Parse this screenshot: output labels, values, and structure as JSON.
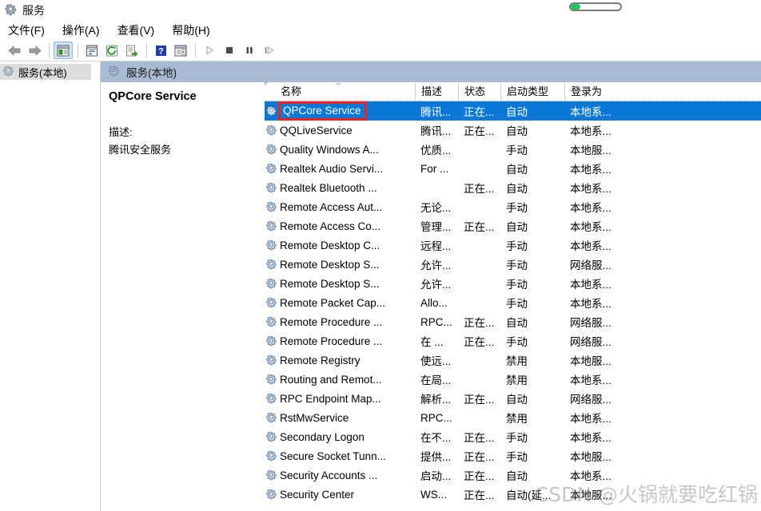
{
  "window": {
    "title": "服务",
    "icon": "services-gear-icon"
  },
  "progress": {
    "percent": 20,
    "fill_color": "#1fc45e"
  },
  "menu": {
    "items": [
      {
        "label": "文件(F)",
        "name": "menu-file"
      },
      {
        "label": "操作(A)",
        "name": "menu-action"
      },
      {
        "label": "查看(V)",
        "name": "menu-view"
      },
      {
        "label": "帮助(H)",
        "name": "menu-help"
      }
    ]
  },
  "toolbar": {
    "buttons": [
      {
        "name": "back-arrow-icon",
        "glyph": "←"
      },
      {
        "name": "forward-arrow-icon",
        "glyph": "→"
      },
      {
        "name": "show-hide-tree-icon",
        "glyph": "▤"
      },
      {
        "name": "properties-icon",
        "glyph": "▤"
      },
      {
        "name": "refresh-icon",
        "glyph": "↻"
      },
      {
        "name": "export-list-icon",
        "glyph": "☰"
      },
      {
        "name": "help-icon",
        "glyph": "?"
      },
      {
        "name": "show-action-pane-icon",
        "glyph": "▤"
      },
      {
        "name": "start-service-icon",
        "glyph": "▶"
      },
      {
        "name": "stop-service-icon",
        "glyph": "■"
      },
      {
        "name": "pause-service-icon",
        "glyph": "❙❙"
      },
      {
        "name": "restart-service-icon",
        "glyph": "❚▶"
      }
    ]
  },
  "tree": {
    "items": [
      {
        "label": "服务(本地)",
        "name": "tree-item-services-local",
        "selected": true
      }
    ]
  },
  "pane": {
    "header_label": "服务(本地)"
  },
  "detail": {
    "service_name": "QPCore Service",
    "description_label": "描述:",
    "description_text": "腾讯安全服务"
  },
  "list": {
    "columns": [
      {
        "key": "name",
        "label": "名称",
        "sorted": "asc"
      },
      {
        "key": "desc",
        "label": "描述"
      },
      {
        "key": "state",
        "label": "状态"
      },
      {
        "key": "start",
        "label": "启动类型"
      },
      {
        "key": "logon",
        "label": "登录为"
      }
    ],
    "rows": [
      {
        "name": "QPCore Service",
        "desc": "腾讯...",
        "state": "正在...",
        "start": "自动",
        "logon": "本地系...",
        "selected": true,
        "annotated": true
      },
      {
        "name": "QQLiveService",
        "desc": "腾讯...",
        "state": "正在...",
        "start": "自动",
        "logon": "本地系..."
      },
      {
        "name": "Quality Windows A...",
        "desc": "优质...",
        "state": "",
        "start": "手动",
        "logon": "本地服..."
      },
      {
        "name": "Realtek Audio Servi...",
        "desc": "For ...",
        "state": "",
        "start": "自动",
        "logon": "本地系..."
      },
      {
        "name": "Realtek Bluetooth ...",
        "desc": "",
        "state": "正在...",
        "start": "自动",
        "logon": "本地系..."
      },
      {
        "name": "Remote Access Aut...",
        "desc": "无论...",
        "state": "",
        "start": "手动",
        "logon": "本地系..."
      },
      {
        "name": "Remote Access Co...",
        "desc": "管理...",
        "state": "正在...",
        "start": "自动",
        "logon": "本地系..."
      },
      {
        "name": "Remote Desktop C...",
        "desc": "远程...",
        "state": "",
        "start": "手动",
        "logon": "本地系..."
      },
      {
        "name": "Remote Desktop S...",
        "desc": "允许...",
        "state": "",
        "start": "手动",
        "logon": "网络服..."
      },
      {
        "name": "Remote Desktop S...",
        "desc": "允许...",
        "state": "",
        "start": "手动",
        "logon": "本地系..."
      },
      {
        "name": "Remote Packet Cap...",
        "desc": "Allo...",
        "state": "",
        "start": "手动",
        "logon": "本地系..."
      },
      {
        "name": "Remote Procedure ...",
        "desc": "RPC...",
        "state": "正在...",
        "start": "自动",
        "logon": "网络服..."
      },
      {
        "name": "Remote Procedure ...",
        "desc": "在 ...",
        "state": "正在...",
        "start": "手动",
        "logon": "网络服..."
      },
      {
        "name": "Remote Registry",
        "desc": "使远...",
        "state": "",
        "start": "禁用",
        "logon": "本地服..."
      },
      {
        "name": "Routing and Remot...",
        "desc": "在局...",
        "state": "",
        "start": "禁用",
        "logon": "本地系..."
      },
      {
        "name": "RPC Endpoint Map...",
        "desc": "解析...",
        "state": "正在...",
        "start": "自动",
        "logon": "网络服..."
      },
      {
        "name": "RstMwService",
        "desc": "RPC...",
        "state": "",
        "start": "禁用",
        "logon": "本地系..."
      },
      {
        "name": "Secondary Logon",
        "desc": "在不...",
        "state": "正在...",
        "start": "手动",
        "logon": "本地系..."
      },
      {
        "name": "Secure Socket Tunn...",
        "desc": "提供...",
        "state": "正在...",
        "start": "手动",
        "logon": "本地服..."
      },
      {
        "name": "Security Accounts ...",
        "desc": "启动...",
        "state": "正在...",
        "start": "自动",
        "logon": "本地系..."
      },
      {
        "name": "Security Center",
        "desc": "WS...",
        "state": "正在...",
        "start": "自动(延...",
        "logon": "本地服..."
      }
    ]
  },
  "watermark": {
    "text": "CSDN @火锅就要吃红锅"
  },
  "colors": {
    "selection": "#0a78d4",
    "annotation": "#ee2222",
    "pane_header": "#a9bbd3",
    "toolbar_active": "#cfe4f7"
  }
}
